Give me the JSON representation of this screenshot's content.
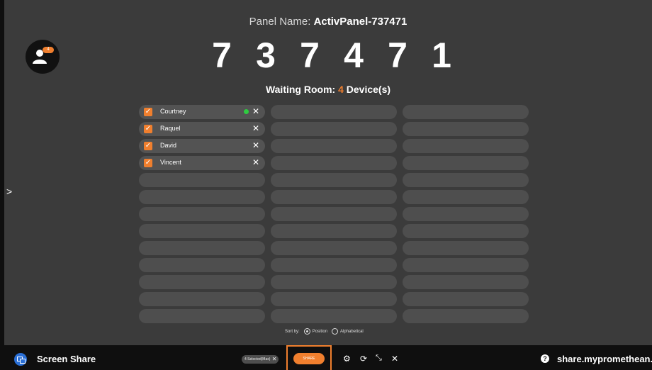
{
  "panel": {
    "label": "Panel Name: ",
    "name": "ActivPanel-737471"
  },
  "code_digits": [
    "7",
    "3",
    "7",
    "4",
    "7",
    "1"
  ],
  "waiting": {
    "prefix": "Waiting Room: ",
    "count": "4",
    "suffix": " Device(s)"
  },
  "avatar": {
    "icon": "users-icon",
    "badge": "4"
  },
  "devices": [
    {
      "name": "Courtney",
      "checked": true,
      "online": true
    },
    {
      "name": "Raquel",
      "checked": true,
      "online": false
    },
    {
      "name": "David",
      "checked": true,
      "online": false
    },
    {
      "name": "Vincent",
      "checked": true,
      "online": false
    }
  ],
  "grid": {
    "columns": 3,
    "rows": 13
  },
  "sort": {
    "label": "Sort by:",
    "options": [
      "Position",
      "Alphabetical"
    ],
    "selected": "Position"
  },
  "bottom": {
    "app_title": "Screen Share",
    "selected_pill": "4 Selected(Max)",
    "share_label": "SHARE",
    "url": "share.mypromethean.com",
    "accent": "#f07f2e"
  }
}
